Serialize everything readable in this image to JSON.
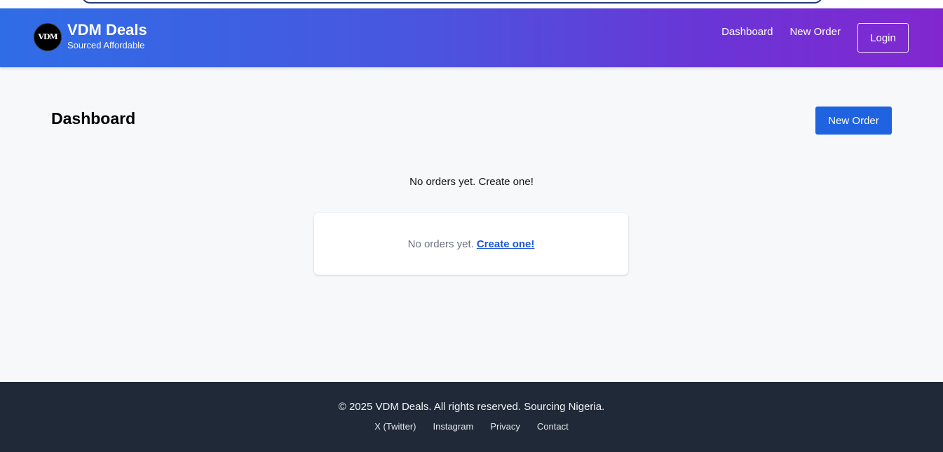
{
  "header": {
    "brand_name": "VDM Deals",
    "brand_tagline": "Sourced Affordable",
    "logo_text": "VDM",
    "nav": [
      {
        "label": "Dashboard"
      },
      {
        "label": "New Order"
      }
    ],
    "login_label": "Login"
  },
  "main": {
    "title": "Dashboard",
    "new_order_button": "New Order",
    "empty_message": "No orders yet. Create one!",
    "card": {
      "text": "No orders yet.",
      "link": "Create one!"
    }
  },
  "footer": {
    "copyright": "© 2025 VDM Deals. All rights reserved. Sourcing Nigeria.",
    "links": [
      {
        "label": "X (Twitter)"
      },
      {
        "label": "Instagram"
      },
      {
        "label": "Privacy"
      },
      {
        "label": "Contact"
      }
    ]
  },
  "colors": {
    "header_gradient_start": "#2f6de6",
    "header_gradient_end": "#8227d0",
    "primary_button": "#1f63e0",
    "link": "#1f56d6",
    "footer_bg": "#1f2937"
  }
}
